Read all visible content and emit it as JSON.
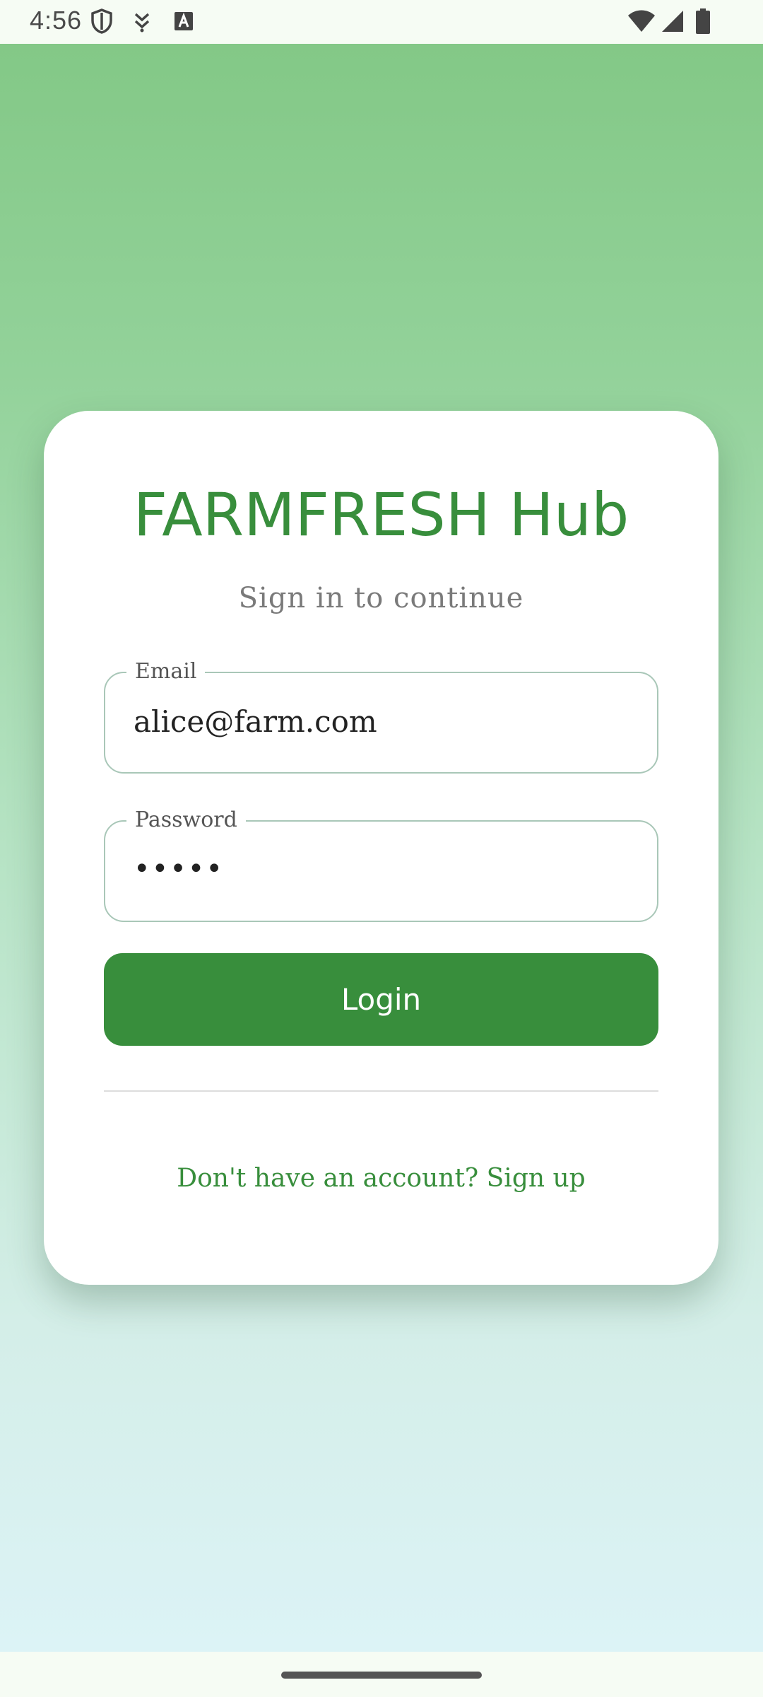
{
  "status_bar": {
    "time": "4:56",
    "icons_left": [
      "shield-icon",
      "download-icon",
      "text-a-icon"
    ],
    "icons_right": [
      "wifi-icon",
      "signal-icon",
      "battery-icon"
    ]
  },
  "colors": {
    "accent": "#388e3c",
    "gradient_top": "#81c784",
    "gradient_bottom": "#ddf4f8"
  },
  "login_card": {
    "title": "FARMFRESH Hub",
    "subtitle": "Sign in to continue",
    "email": {
      "label": "Email",
      "value": "alice@farm.com"
    },
    "password": {
      "label": "Password",
      "masked_value": "•••••"
    },
    "login_button": "Login",
    "signup_link": "Don't have an account? Sign up"
  }
}
